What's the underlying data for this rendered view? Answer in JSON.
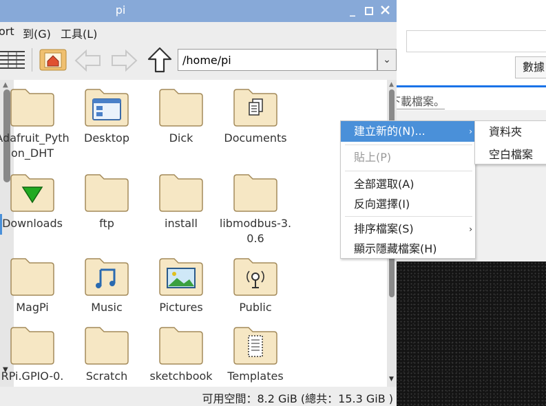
{
  "window": {
    "title": "pi"
  },
  "menubar": {
    "items": [
      "ort",
      "到(G)",
      "工具(L)"
    ]
  },
  "toolbar": {
    "path_value": "/home/pi"
  },
  "files": [
    {
      "label": "Adafruit_Python_DHT",
      "icon": "folder-icon"
    },
    {
      "label": "Desktop",
      "icon": "desktop-folder-icon"
    },
    {
      "label": "Dick",
      "icon": "folder-icon"
    },
    {
      "label": "Documents",
      "icon": "documents-folder-icon"
    },
    {
      "label": "Downloads",
      "icon": "downloads-folder-icon"
    },
    {
      "label": "ftp",
      "icon": "folder-icon"
    },
    {
      "label": "install",
      "icon": "folder-icon"
    },
    {
      "label": "libmodbus-3.0.6",
      "icon": "folder-icon"
    },
    {
      "label": "MagPi",
      "icon": "folder-icon"
    },
    {
      "label": "Music",
      "icon": "music-folder-icon"
    },
    {
      "label": "Pictures",
      "icon": "pictures-folder-icon"
    },
    {
      "label": "Public",
      "icon": "public-folder-icon"
    },
    {
      "label": "RPi.GPIO-0.",
      "icon": "folder-icon"
    },
    {
      "label": "Scratch",
      "icon": "folder-icon"
    },
    {
      "label": "sketchbook",
      "icon": "folder-icon"
    },
    {
      "label": "Templates",
      "icon": "templates-folder-icon"
    }
  ],
  "status": {
    "text": "可用空間：8.2 GiB (總共：15.3 GiB )"
  },
  "context_menu": {
    "items": [
      "建立新的(N)...",
      "貼上(P)",
      "全部選取(A)",
      "反向選擇(I)",
      "排序檔案(S)",
      "顯示隱藏檔案(H)"
    ],
    "submenu": [
      "資料夾",
      "空白檔案"
    ]
  },
  "background_app": {
    "button_label": "數據",
    "hint_text": "下載檔案。"
  },
  "colors": {
    "titlebar": "#87a9d8",
    "highlight": "#4a90d9",
    "folder_fill": "#f6e7c4",
    "folder_stroke": "#a38a5a"
  }
}
